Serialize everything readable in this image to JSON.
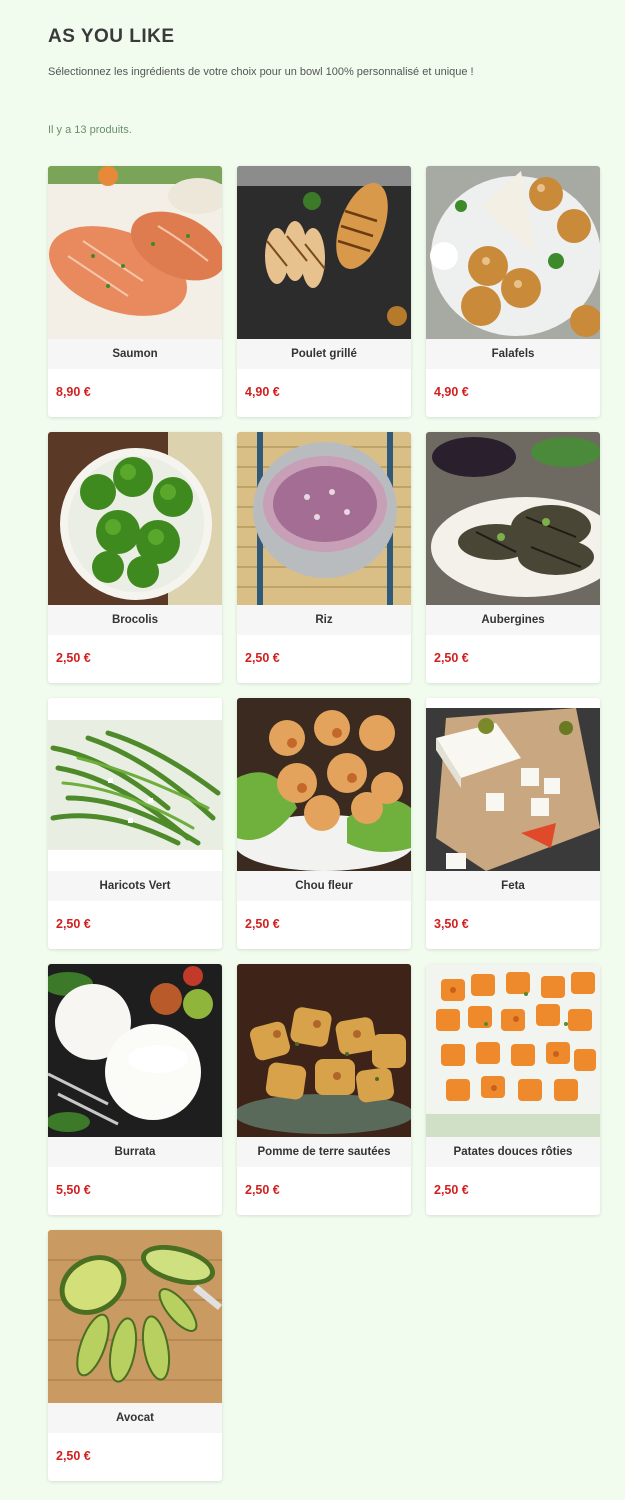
{
  "header": {
    "title": "AS YOU LIKE",
    "description": "Sélectionnez les ingrédients de votre choix pour un bowl 100% personnalisé et unique !",
    "count_text": "Il y a 13 produits."
  },
  "products": [
    {
      "name": "Saumon",
      "price": "8,90 €"
    },
    {
      "name": "Poulet grillé",
      "price": "4,90 €"
    },
    {
      "name": "Falafels",
      "price": "4,90 €"
    },
    {
      "name": "Brocolis",
      "price": "2,50 €"
    },
    {
      "name": "Riz",
      "price": "2,50 €"
    },
    {
      "name": "Aubergines",
      "price": "2,50 €"
    },
    {
      "name": "Haricots Vert",
      "price": "2,50 €"
    },
    {
      "name": "Chou fleur",
      "price": "2,50 €"
    },
    {
      "name": "Feta",
      "price": "3,50 €"
    },
    {
      "name": "Burrata",
      "price": "5,50 €"
    },
    {
      "name": "Pomme de terre sautées",
      "price": "2,50 €"
    },
    {
      "name": "Patates douces rôties",
      "price": "2,50 €"
    },
    {
      "name": "Avocat",
      "price": "2,50 €"
    }
  ],
  "colors": {
    "background": "#f1fcee",
    "price": "#d11f1f",
    "title": "#3a3a3a"
  }
}
